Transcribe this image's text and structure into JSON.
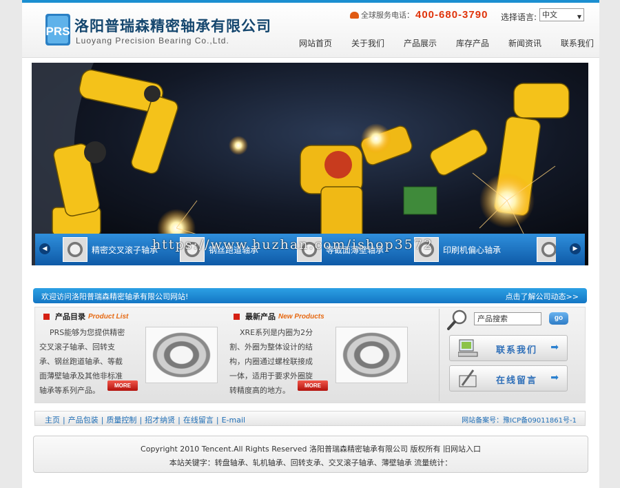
{
  "header": {
    "company_cn": "洛阳普瑞森精密轴承有限公司",
    "company_en": "Luoyang Precision Bearing Co.,Ltd.",
    "logo_letters": "PRS",
    "hotline_label": "全球服务电话：",
    "hotline_number": "400-680-3790",
    "language_label": "选择语言:",
    "language_selected": "中文"
  },
  "nav": {
    "items": [
      {
        "label": "网站首页"
      },
      {
        "label": "关于我们"
      },
      {
        "label": "产品展示"
      },
      {
        "label": "库存产品"
      },
      {
        "label": "新闻资讯"
      },
      {
        "label": "联系我们"
      }
    ]
  },
  "banner": {
    "carousel": [
      {
        "label": "精密交叉滚子轴承"
      },
      {
        "label": "钢丝跑道轴承"
      },
      {
        "label": "等截面薄壁轴承"
      },
      {
        "label": "印刷机偏心轴承"
      }
    ],
    "watermark": "https://www.huzhan.com/ishop3572"
  },
  "welcome": {
    "text": "欢迎访问洛阳普瑞森精密轴承有限公司网站!",
    "link": "点击了解公司动态>>"
  },
  "product_list": {
    "title_cn": "产品目录",
    "title_en": "Product List",
    "text": "PRS能够为您提供精密交叉滚子轴承、回转支承、钢丝跑道轴承、等截面薄壁轴承及其他非标准轴承等系列产品。",
    "more": "MORE"
  },
  "new_products": {
    "title_cn": "最新产品",
    "title_en": "New Products",
    "text": "XRE系列是内圈为2分割、外圈为整体设计的结构，内圈通过螺栓联接成一体，适用于要求外圈旋转精度高的地方。",
    "more": "MORE"
  },
  "sidebar": {
    "search_placeholder": "产品搜索",
    "search_button": "go",
    "contact_label": "联系我们",
    "message_label": "在线留言"
  },
  "linkbar": {
    "links": [
      "主页",
      "产品包装",
      "质量控制",
      "招才纳贤",
      "在线留言",
      "E-mail"
    ],
    "record": "网站备案号：豫ICP备09011861号-1"
  },
  "footer": {
    "line1": "Copyright 2010 Tencent.All Rights Reserved    洛阳普瑞森精密轴承有限公司   版权所有   旧网站入口",
    "line2": "本站关键字：转盘轴承、轧机轴承、回转支承、交叉滚子轴承、薄壁轴承  流量统计："
  },
  "colors": {
    "brand_blue": "#1b8fd1",
    "hotline_red": "#e0330a",
    "accent_orange": "#e66912"
  }
}
